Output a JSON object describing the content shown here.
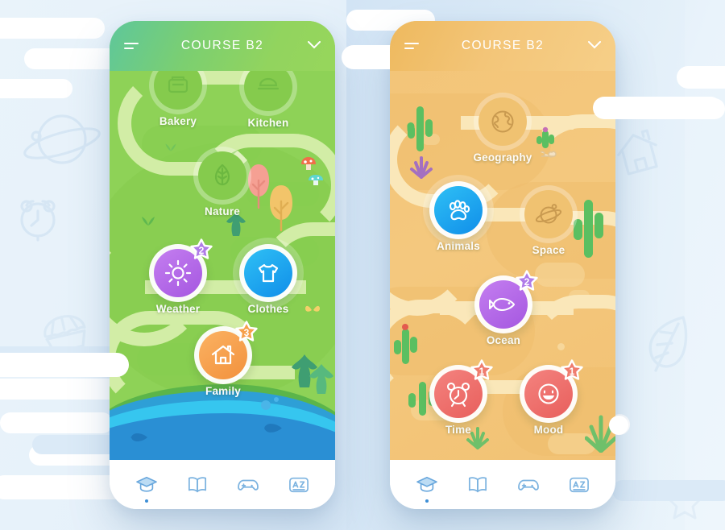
{
  "background": {
    "ghost_icons": [
      "planet-icon",
      "alarm-clock-icon",
      "cupcake-icon",
      "house-icon",
      "leaf-icon",
      "paw-icon"
    ]
  },
  "phones": [
    {
      "id": "green",
      "theme": "green",
      "header": {
        "title": "COURSE B2",
        "menu_icon": "hamburger-icon",
        "dropdown_icon": "chevron-down-icon"
      },
      "nodes": [
        {
          "label": "Bakery",
          "icon": "bakery-icon",
          "state": "locked",
          "badge": null
        },
        {
          "label": "Kitchen",
          "icon": "kitchen-icon",
          "state": "locked",
          "badge": null
        },
        {
          "label": "Nature",
          "icon": "leaf-icon",
          "state": "locked",
          "badge": null
        },
        {
          "label": "Weather",
          "icon": "sun-icon",
          "state": "completed",
          "badge": "2",
          "color": "#b466e8"
        },
        {
          "label": "Clothes",
          "icon": "tshirt-icon",
          "state": "active",
          "badge": null,
          "color": "#1aa8f0"
        },
        {
          "label": "Family",
          "icon": "house-icon",
          "state": "completed",
          "badge": "3",
          "color": "#f6a04a"
        }
      ],
      "nav": [
        {
          "icon": "graduation-cap-icon",
          "active": true
        },
        {
          "icon": "book-icon",
          "active": false
        },
        {
          "icon": "gamepad-icon",
          "active": false
        },
        {
          "icon": "az-dictionary-icon",
          "active": false
        }
      ]
    },
    {
      "id": "orange",
      "theme": "orange",
      "header": {
        "title": "COURSE B2",
        "menu_icon": "hamburger-icon",
        "dropdown_icon": "chevron-down-icon"
      },
      "nodes": [
        {
          "label": "Geography",
          "icon": "globe-icon",
          "state": "locked",
          "badge": null
        },
        {
          "label": "Animals",
          "icon": "paw-icon",
          "state": "active",
          "badge": null,
          "color": "#1aa8f0"
        },
        {
          "label": "Space",
          "icon": "planet-icon",
          "state": "locked",
          "badge": null
        },
        {
          "label": "Ocean",
          "icon": "fish-icon",
          "state": "completed",
          "badge": "2",
          "color": "#b466e8"
        },
        {
          "label": "Time",
          "icon": "alarm-clock-icon",
          "state": "completed",
          "badge": "1",
          "color": "#ef6f6c"
        },
        {
          "label": "Mood",
          "icon": "smiley-icon",
          "state": "completed",
          "badge": "1",
          "color": "#ef6f6c"
        }
      ],
      "nav": [
        {
          "icon": "graduation-cap-icon",
          "active": true
        },
        {
          "icon": "book-icon",
          "active": false
        },
        {
          "icon": "gamepad-icon",
          "active": false
        },
        {
          "icon": "az-dictionary-icon",
          "active": false
        }
      ]
    }
  ],
  "colors": {
    "green_map": "#8ed257",
    "green_path": "#d2eda6",
    "orange_map": "#f3c477",
    "orange_path": "#fae7b9",
    "nav_icon": "#7cb3e0",
    "nav_active": "#3d8fd6",
    "badge_purple": "#b07ce8",
    "badge_orange": "#f6a04a",
    "badge_red": "#ef6f6c"
  }
}
